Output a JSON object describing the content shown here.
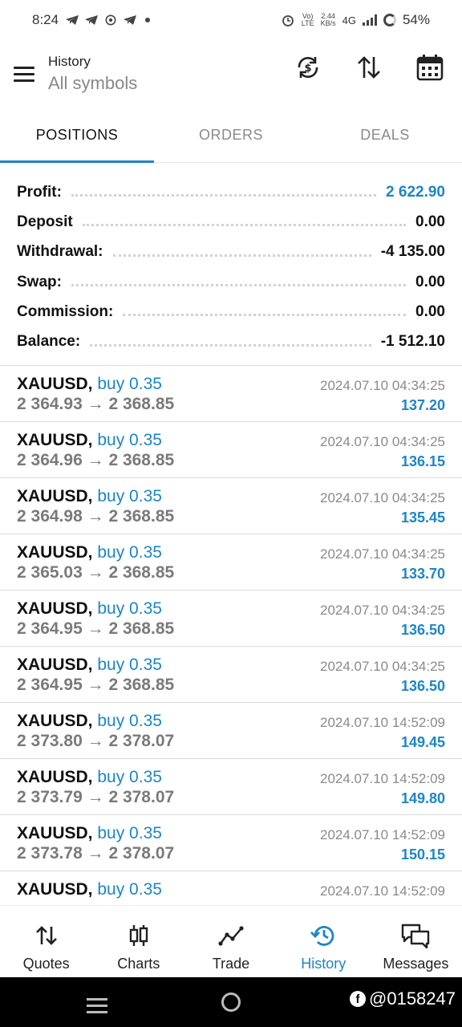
{
  "status_bar": {
    "time": "8:24",
    "net_speed_top": "2.44",
    "net_speed_bottom": "KB/s",
    "volte_top": "Vo)",
    "volte_bottom": "LTE",
    "network": "4G",
    "battery": "54%"
  },
  "header": {
    "title": "History",
    "subtitle": "All symbols"
  },
  "tabs": [
    {
      "label": "POSITIONS",
      "active": true
    },
    {
      "label": "ORDERS",
      "active": false
    },
    {
      "label": "DEALS",
      "active": false
    }
  ],
  "summary": [
    {
      "label": "Profit:",
      "value": "2 622.90",
      "highlight": true
    },
    {
      "label": "Deposit",
      "value": "0.00",
      "highlight": false
    },
    {
      "label": "Withdrawal:",
      "value": "-4 135.00",
      "highlight": false
    },
    {
      "label": "Swap:",
      "value": "0.00",
      "highlight": false
    },
    {
      "label": "Commission:",
      "value": "0.00",
      "highlight": false
    },
    {
      "label": "Balance:",
      "value": "-1 512.10",
      "highlight": false
    }
  ],
  "deals": [
    {
      "symbol": "XAUUSD,",
      "side": "buy 0.35",
      "open": "2 364.93",
      "arrow": "→",
      "close": "2 368.85",
      "time": "2024.07.10 04:34:25",
      "profit": "137.20"
    },
    {
      "symbol": "XAUUSD,",
      "side": "buy 0.35",
      "open": "2 364.96",
      "arrow": "→",
      "close": "2 368.85",
      "time": "2024.07.10 04:34:25",
      "profit": "136.15"
    },
    {
      "symbol": "XAUUSD,",
      "side": "buy 0.35",
      "open": "2 364.98",
      "arrow": "→",
      "close": "2 368.85",
      "time": "2024.07.10 04:34:25",
      "profit": "135.45"
    },
    {
      "symbol": "XAUUSD,",
      "side": "buy 0.35",
      "open": "2 365.03",
      "arrow": "→",
      "close": "2 368.85",
      "time": "2024.07.10 04:34:25",
      "profit": "133.70"
    },
    {
      "symbol": "XAUUSD,",
      "side": "buy 0.35",
      "open": "2 364.95",
      "arrow": "→",
      "close": "2 368.85",
      "time": "2024.07.10 04:34:25",
      "profit": "136.50"
    },
    {
      "symbol": "XAUUSD,",
      "side": "buy 0.35",
      "open": "2 364.95",
      "arrow": "→",
      "close": "2 368.85",
      "time": "2024.07.10 04:34:25",
      "profit": "136.50"
    },
    {
      "symbol": "XAUUSD,",
      "side": "buy 0.35",
      "open": "2 373.80",
      "arrow": "→",
      "close": "2 378.07",
      "time": "2024.07.10 14:52:09",
      "profit": "149.45"
    },
    {
      "symbol": "XAUUSD,",
      "side": "buy 0.35",
      "open": "2 373.79",
      "arrow": "→",
      "close": "2 378.07",
      "time": "2024.07.10 14:52:09",
      "profit": "149.80"
    },
    {
      "symbol": "XAUUSD,",
      "side": "buy 0.35",
      "open": "2 373.78",
      "arrow": "→",
      "close": "2 378.07",
      "time": "2024.07.10 14:52:09",
      "profit": "150.15"
    },
    {
      "symbol": "XAUUSD,",
      "side": "buy 0.35",
      "open": "",
      "arrow": "",
      "close": "",
      "time": "2024.07.10 14:52:09",
      "profit": ""
    }
  ],
  "bottom_nav": [
    {
      "label": "Quotes",
      "icon": "quotes-icon",
      "active": false
    },
    {
      "label": "Charts",
      "icon": "charts-icon",
      "active": false
    },
    {
      "label": "Trade",
      "icon": "trade-icon",
      "active": false
    },
    {
      "label": "History",
      "icon": "history-icon",
      "active": true
    },
    {
      "label": "Messages",
      "icon": "messages-icon",
      "active": false
    }
  ],
  "watermark": {
    "text": "@0158247"
  },
  "colors": {
    "accent": "#1c86c6",
    "text": "#111111",
    "muted": "#8a8a8a"
  }
}
